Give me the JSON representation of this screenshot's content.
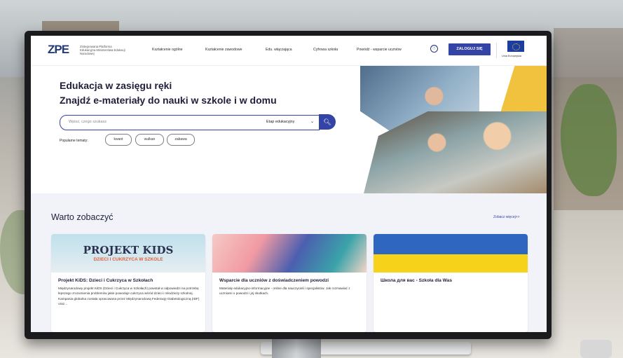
{
  "header": {
    "logo": "ZPE",
    "logo_sub": "Zintegrowana Platforma Edukacyjna Ministerstwa Edukacji Narodowej",
    "nav": [
      "Kształcenie ogólne",
      "Kształcenie zawodowe",
      "Edu. włączająca",
      "Cyfrowa szkoła",
      "Powódź - wsparcie uczniów"
    ],
    "info_icon": "ⓘ",
    "login_label": "ZALOGUJ SIĘ",
    "eu_label": "Unia Europejska"
  },
  "hero": {
    "line1": "Edukacja w zasięgu ręki",
    "line2": "Znajdź e-materiały do nauki w szkole i w domu",
    "search_placeholder": "Wpisz, czego szukasz",
    "select_value": "Etap edukacyjny",
    "search_icon": "search-icon",
    "popular_label": "Popularne tematy:",
    "tags": [
      "kwant",
      "wulkan",
      "zabawa"
    ]
  },
  "section": {
    "title": "Warto zobaczyć",
    "more_link": "Zobacz więcej>>",
    "cards": [
      {
        "img_title": "PROJEKT KIDS",
        "img_sub": "DZIECI I CUKRZYCA W SZKOLE",
        "title": "Projekt KiDS: Dzieci i Cukrzyca w Szkołach",
        "desc": "Międzynarodowy projekt KiDS (Dzieci i Cukrzyca w Szkołach) powstał w odpowiedzi na potrzebę lepszego zrozumienia problemów jakie powoduje cukrzyca wśród dzieci i młodzieży szkolnej. Kampania globalna została opracowana przez Międzynarodową Federację Diabetologiczną (IDF) oraz..."
      },
      {
        "title": "Wsparcie dla uczniów z doświadczeniem powodzi",
        "desc": "Materiały edukacyjno-informacyjne - online dla nauczycieli i specjalistów. Jak rozmawiać z uczniami o powodzi i jej skutkach."
      },
      {
        "title": "Школа для вас - Szkoła dla Was",
        "desc": ""
      }
    ]
  }
}
